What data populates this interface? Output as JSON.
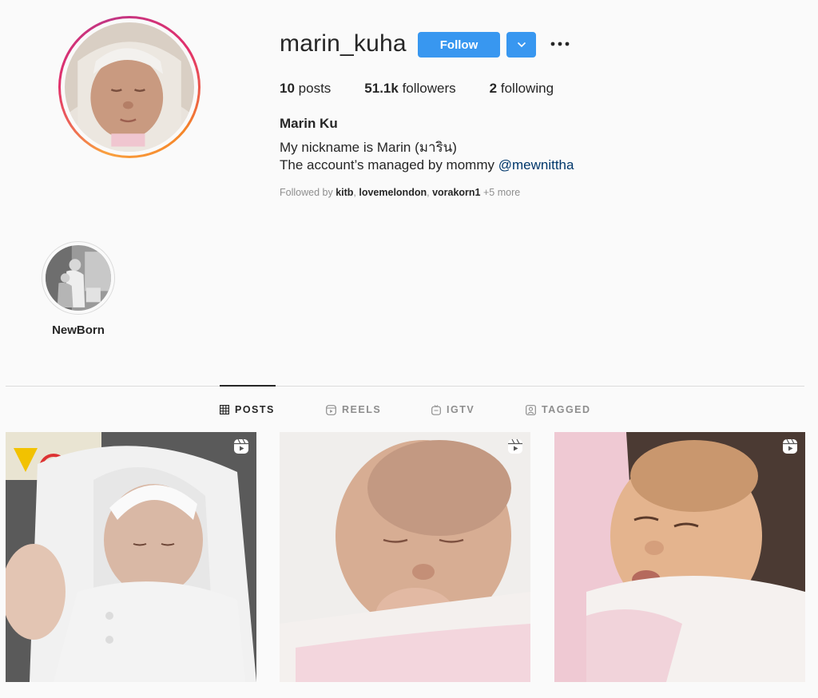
{
  "profile": {
    "username": "marin_kuha",
    "follow_label": "Follow",
    "posts_count": "10",
    "posts_label": "posts",
    "followers_count": "51.1k",
    "followers_label": "followers",
    "following_count": "2",
    "following_label": "following",
    "full_name": "Marin Ku",
    "bio_line1": "My nickname is Marin (มาริน)",
    "bio_line2_prefix": "The account’s managed by mommy",
    "bio_mention": "@mewnittha",
    "followed_by_prefix": "Followed by",
    "followed_by_users": [
      "kitb",
      "lovemelondon",
      "vorakorn1"
    ],
    "followed_by_more": "+5 more"
  },
  "highlights": [
    {
      "label": "NewBorn"
    }
  ],
  "tabs": [
    {
      "label": "POSTS",
      "icon": "grid-icon",
      "active": true
    },
    {
      "label": "REELS",
      "icon": "reels-icon",
      "active": false
    },
    {
      "label": "IGTV",
      "icon": "igtv-icon",
      "active": false
    },
    {
      "label": "TAGGED",
      "icon": "tagged-icon",
      "active": false
    }
  ],
  "posts": [
    {
      "type": "reel",
      "icon": "reel-icon"
    },
    {
      "type": "reel",
      "icon": "reel-icon"
    },
    {
      "type": "reel",
      "icon": "reel-icon"
    }
  ],
  "colors": {
    "accent": "#3897f0",
    "mention": "#00376b",
    "muted": "#8e8e8e",
    "text": "#262626",
    "background": "#fafafa"
  }
}
